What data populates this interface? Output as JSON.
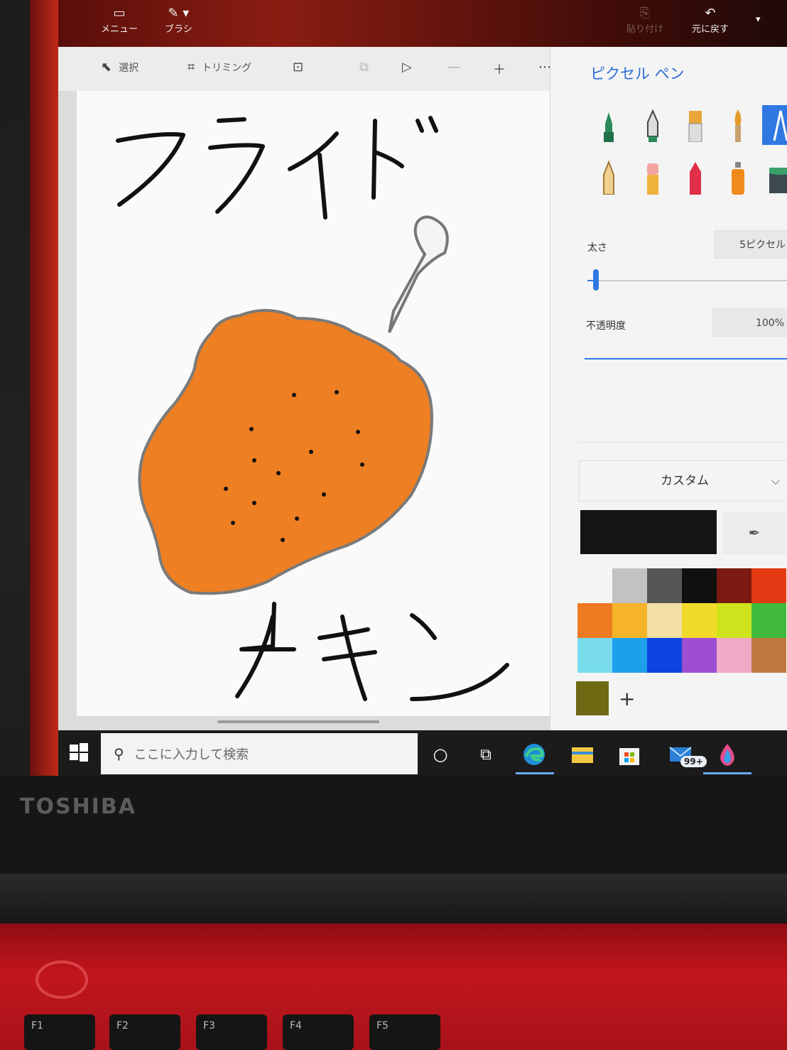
{
  "titlebar": {
    "menu_label": "メニュー",
    "brush_label": "ブラシ",
    "paste_label": "貼り付け",
    "undo_label": "元に戻す"
  },
  "toolbar": {
    "select_label": "選択",
    "crop_label": "トリミング"
  },
  "panel": {
    "title": "ピクセル ペン",
    "thickness_label": "太さ",
    "thickness_value": "5ピクセル",
    "thickness_level": 0.04,
    "opacity_label": "不透明度",
    "opacity_value": "100%",
    "opacity_level": 1.0,
    "palette_dropdown": "カスタム",
    "current_color": "#151515",
    "custom_color": "#6e6a14",
    "add_label": "+"
  },
  "palette": [
    "#f5f5f5",
    "#c2c2c2",
    "#565656",
    "#101010",
    "#7a1a10",
    "#e23a12",
    "#ee7a22",
    "#f6b42a",
    "#f2e0a6",
    "#f2da2a",
    "#cfe41c",
    "#3fba3a",
    "#78dcee",
    "#1da0ea",
    "#0c44e0",
    "#9e4ed0",
    "#f0aac8",
    "#c07842"
  ],
  "canvas": {
    "title_text": "フライド",
    "bottom_text": "チキン",
    "chicken_color": "#ee7f22"
  },
  "taskbar": {
    "search_placeholder": "ここに入力して検索",
    "mail_badge": "99+"
  },
  "laptop": {
    "brand": "TOSHIBA",
    "f1": "F1",
    "f2": "F2",
    "f3": "F3",
    "f4": "F4",
    "f5": "F5"
  }
}
